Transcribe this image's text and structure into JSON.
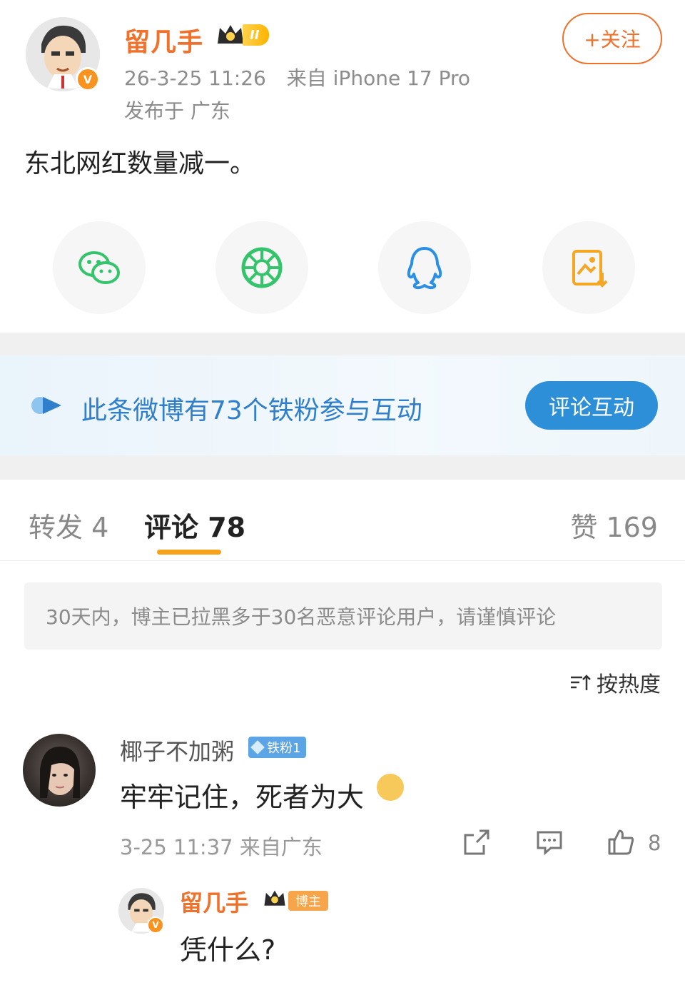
{
  "post": {
    "username": "留几手",
    "vip_level": "II",
    "timestamp": "26-3-25 11:26",
    "source": "来自 iPhone 17 Pro",
    "location": "发布于 广东",
    "follow_label": "+关注",
    "text": "东北网红数量减一。"
  },
  "share": [
    {
      "name": "wechat-icon",
      "color": "#34c46b"
    },
    {
      "name": "moments-icon",
      "color": "#34c46b"
    },
    {
      "name": "qq-icon",
      "color": "#2a8fe6"
    },
    {
      "name": "save-image-icon",
      "color": "#f5a623"
    }
  ],
  "fan_banner": {
    "text": "此条微博有73个铁粉参与互动",
    "button": "评论互动"
  },
  "tabs": {
    "repost": "转发 4",
    "comment": "评论 78",
    "like": "赞 169"
  },
  "notice": "30天内，博主已拉黑多于30名恶意评论用户，请谨慎评论",
  "sort_label": "按热度",
  "comment": {
    "username": "椰子不加粥",
    "fan_badge": "铁粉1",
    "text": "牢牢记住，死者为大",
    "timestamp": "3-25 11:37",
    "location": "来自广东",
    "like_count": "8"
  },
  "reply": {
    "username": "留几手",
    "tag": "博主",
    "text": "凭什么?"
  },
  "colors": {
    "accent_orange": "#f0712b",
    "link_blue": "#2f7fcc",
    "tab_underline": "#f7a21b"
  }
}
